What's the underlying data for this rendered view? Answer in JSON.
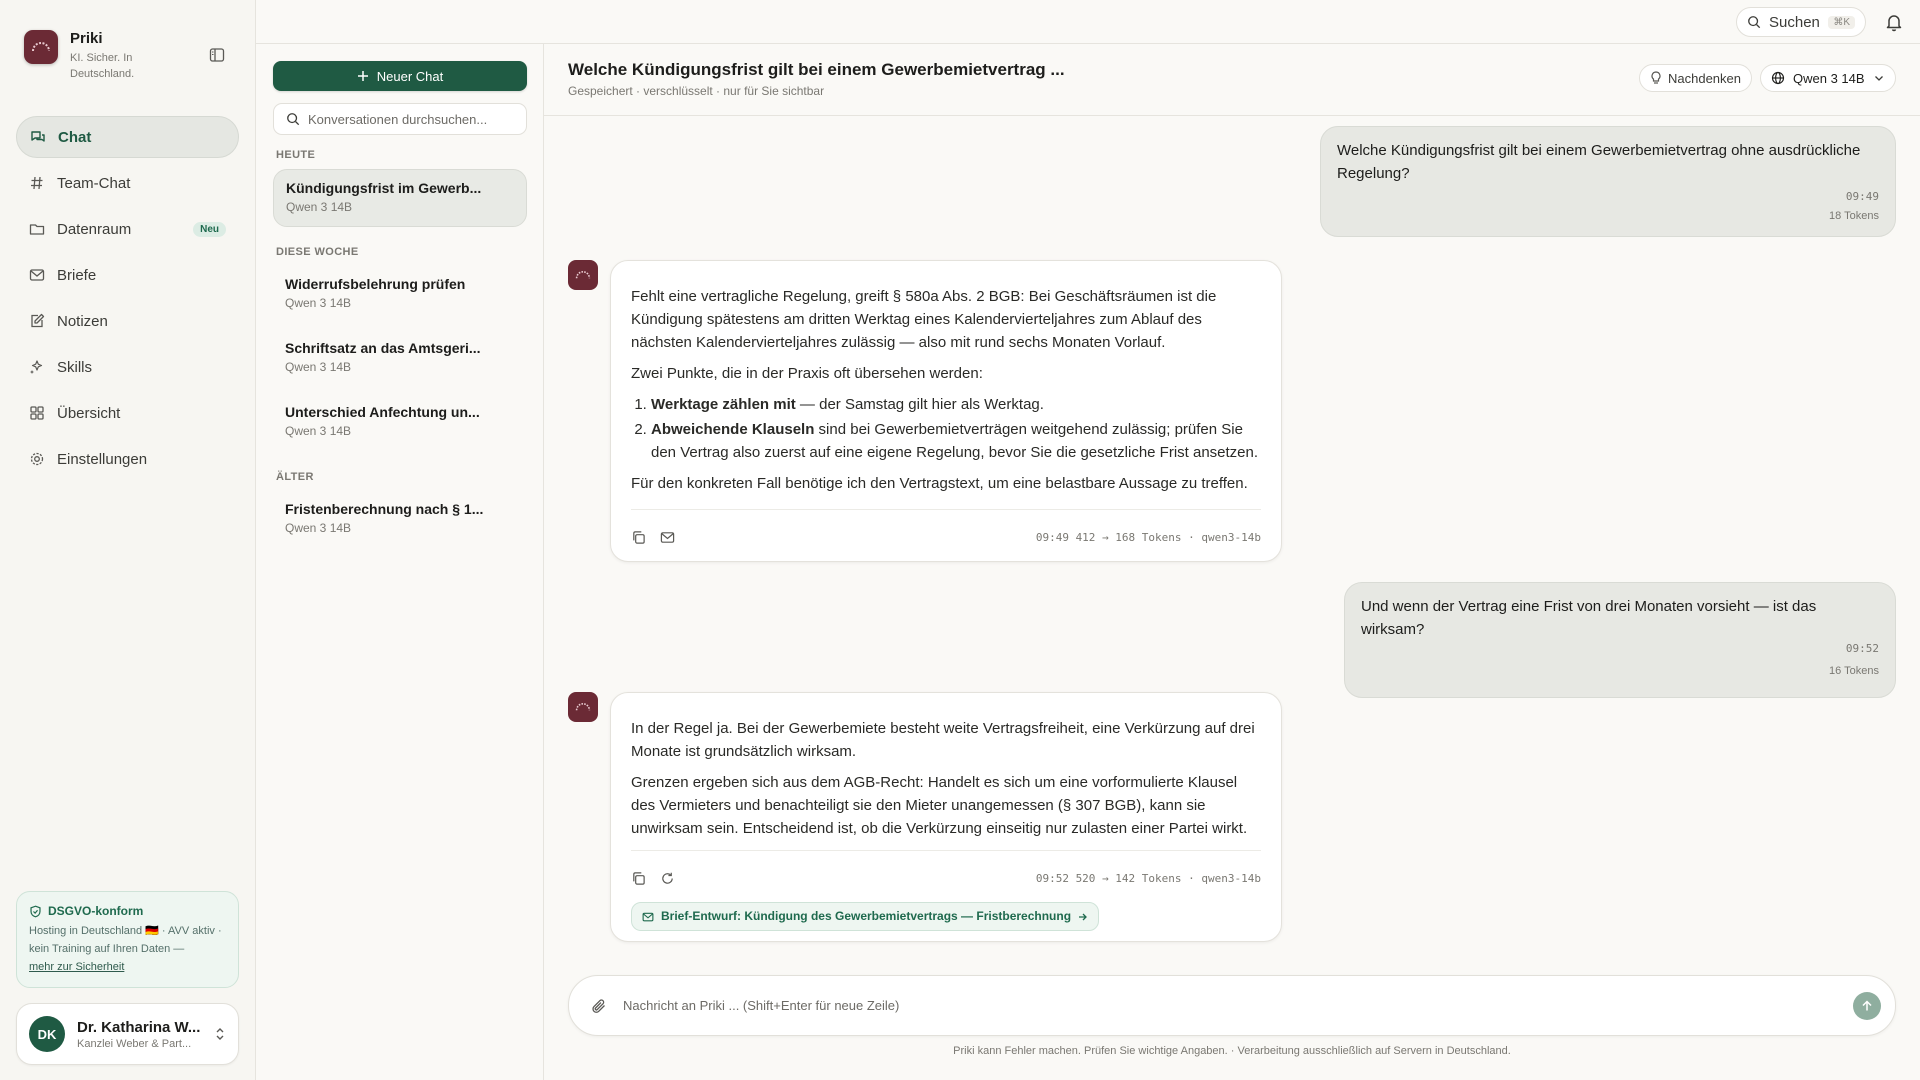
{
  "topbar": {
    "search_label": "Suchen",
    "search_shortcut": "⌘K"
  },
  "brand": {
    "name": "Priki",
    "tagline": "KI. Sicher. In Deutschland."
  },
  "sidebar": {
    "items": [
      {
        "label": "Chat"
      },
      {
        "label": "Team-Chat"
      },
      {
        "label": "Datenraum",
        "badge": "Neu"
      },
      {
        "label": "Briefe"
      },
      {
        "label": "Notizen"
      },
      {
        "label": "Skills"
      },
      {
        "label": "Übersicht"
      },
      {
        "label": "Einstellungen"
      }
    ],
    "dsgvo": {
      "title": "DSGVO-konform",
      "text": "Hosting in Deutschland 🇩🇪 · AVV aktiv · kein Training auf Ihren Daten —",
      "link": "mehr zur Sicherheit"
    },
    "user": {
      "initials": "DK",
      "name": "Dr. Katharina W...",
      "org": "Kanzlei Weber & Part..."
    }
  },
  "conversations": {
    "new_chat_label": "Neuer Chat",
    "search_placeholder": "Konversationen durchsuchen...",
    "groups": [
      {
        "label": "HEUTE",
        "items": [
          {
            "title": "Kündigungsfrist im Gewerb...",
            "model": "Qwen 3 14B"
          }
        ]
      },
      {
        "label": "DIESE WOCHE",
        "items": [
          {
            "title": "Widerrufsbelehrung prüfen",
            "model": "Qwen 3 14B"
          },
          {
            "title": "Schriftsatz an das Amtsgeri...",
            "model": "Qwen 3 14B"
          },
          {
            "title": "Unterschied Anfechtung un...",
            "model": "Qwen 3 14B"
          }
        ]
      },
      {
        "label": "ÄLTER",
        "items": [
          {
            "title": "Fristenberechnung nach § 1...",
            "model": "Qwen 3 14B"
          }
        ]
      }
    ]
  },
  "chat": {
    "title": "Welche Kündigungsfrist gilt bei einem Gewerbemietvertrag ...",
    "subtitle": "Gespeichert · verschlüsselt · nur für Sie sichtbar",
    "think_label": "Nachdenken",
    "model_label": "Qwen 3 14B",
    "messages": [
      {
        "role": "user",
        "text": "Welche Kündigungsfrist gilt bei einem Gewerbemietvertrag ohne ausdrückliche Regelung?",
        "time": "09:49",
        "tokens": "18 Tokens"
      },
      {
        "role": "assistant",
        "p1": "Fehlt eine vertragliche Regelung, greift § 580a Abs. 2 BGB: Bei Geschäftsräumen ist die Kündigung spätestens am dritten Werktag eines Kalendervierteljahres zum Ablauf des nächsten Kalendervierteljahres zulässig — also mit rund sechs Monaten Vorlauf.",
        "p2": "Zwei Punkte, die in der Praxis oft übersehen werden:",
        "list": [
          {
            "bold": "Werktage zählen mit",
            "rest": " — der Samstag gilt hier als Werktag."
          },
          {
            "bold": "Abweichende Klauseln",
            "rest": " sind bei Gewerbemietverträgen weitgehend zulässig; prüfen Sie den Vertrag also zuerst auf eine eigene Regelung, bevor Sie die gesetzliche Frist ansetzen."
          }
        ],
        "p3": "Für den konkreten Fall benötige ich den Vertragstext, um eine belastbare Aussage zu treffen.",
        "stats": "09:49 412 → 168 Tokens · qwen3-14b"
      },
      {
        "role": "user",
        "text": "Und wenn der Vertrag eine Frist von drei Monaten vorsieht — ist das wirksam?",
        "time": "09:52",
        "tokens": "16 Tokens"
      },
      {
        "role": "assistant",
        "p1": "In der Regel ja. Bei der Gewerbemiete besteht weite Vertragsfreiheit, eine Verkürzung auf drei Monate ist grundsätzlich wirksam.",
        "p2": "Grenzen ergeben sich aus dem AGB-Recht: Handelt es sich um eine vorformulierte Klausel des Vermieters und benachteiligt sie den Mieter unangemessen (§ 307 BGB), kann sie unwirksam sein. Entscheidend ist, ob die Verkürzung einseitig nur zulasten einer Partei wirkt.",
        "stats": "09:52 520 → 142 Tokens · qwen3-14b",
        "brief_link": "Brief-Entwurf: Kündigung des Gewerbemietvertrags — Fristberechnung"
      }
    ]
  },
  "composer": {
    "placeholder": "Nachricht an Priki ... (Shift+Enter für neue Zeile)",
    "disclaimer": "Priki kann Fehler machen. Prüfen Sie wichtige Angaben. · Verarbeitung ausschließlich auf Servern in Deutschland."
  },
  "colors": {
    "brand_green": "#1f5a43",
    "logo": "#6b2a35",
    "accent_light": "#eef6f1"
  }
}
